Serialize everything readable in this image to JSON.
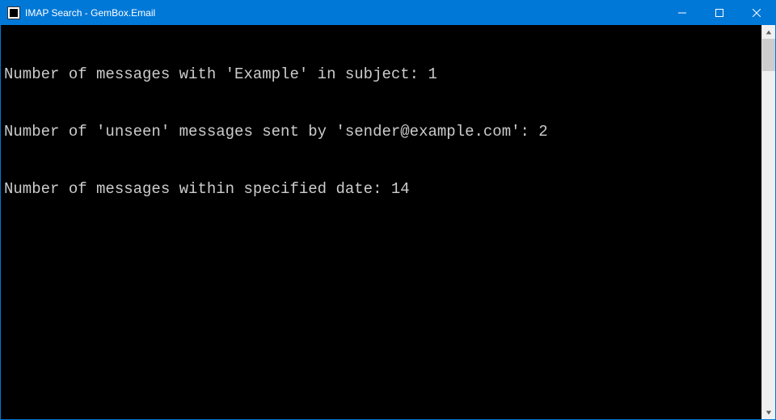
{
  "window": {
    "title": "IMAP Search - GemBox.Email"
  },
  "console": {
    "lines": [
      "Number of messages with 'Example' in subject: 1",
      "Number of 'unseen' messages sent by 'sender@example.com': 2",
      "Number of messages within specified date: 14"
    ]
  }
}
